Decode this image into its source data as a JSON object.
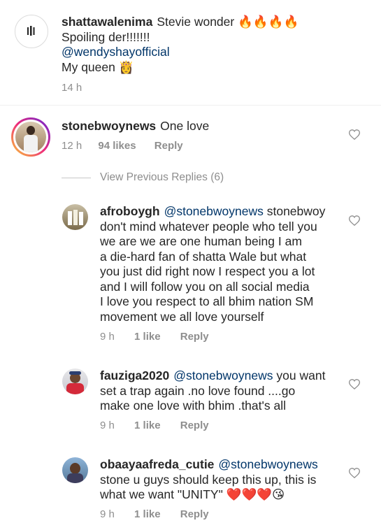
{
  "comments": [
    {
      "username": "shattawalenima",
      "lines": [
        "Stevie wonder 🔥🔥🔥🔥",
        "Spoiling der!!!!!!!",
        "@wendyshayofficial",
        "My queen 👸"
      ],
      "time": "14 h"
    },
    {
      "username": "stonebwoynews",
      "text": "One love",
      "time": "12 h",
      "likes": "94 likes",
      "reply": "Reply"
    }
  ],
  "view_previous": "View Previous Replies (6)",
  "replies": [
    {
      "username": "afroboygh",
      "mention": "@stonebwoynews",
      "first_line_rest": "stonebwoy",
      "lines": [
        "don't mind whatever people who tell you",
        "we are we are one human being I am",
        "a die-hard fan of shatta Wale but what",
        "you just did right now I respect you a lot",
        "and I will follow you on all social media",
        "I love you respect to all bhim nation SM",
        "movement we all love yourself"
      ],
      "time": "9 h",
      "likes": "1 like",
      "reply": "Reply"
    },
    {
      "username": "fauziga2020",
      "mention": "@stonebwoynews",
      "first_line_rest": "you want",
      "lines": [
        "set a trap again .no love found ....go",
        "make one love with bhim .that's all"
      ],
      "time": "9 h",
      "likes": "1 like",
      "reply": "Reply"
    },
    {
      "username": "obaayaafreda_cutie",
      "mention": "@stonebwoynews",
      "first_line_rest": "",
      "lines": [
        "stone u guys should keep this up, this is",
        "what we want \"UNITY\" ❤️❤️❤️😘"
      ],
      "time": "9 h",
      "likes": "1 like",
      "reply": "Reply"
    }
  ],
  "colors": {
    "text": "#262626",
    "meta": "#8e8e8e",
    "mention": "#003569",
    "heart_outline": "#8e8e8e"
  },
  "icons": [
    "avatar-logo-icon",
    "heart-icon"
  ]
}
